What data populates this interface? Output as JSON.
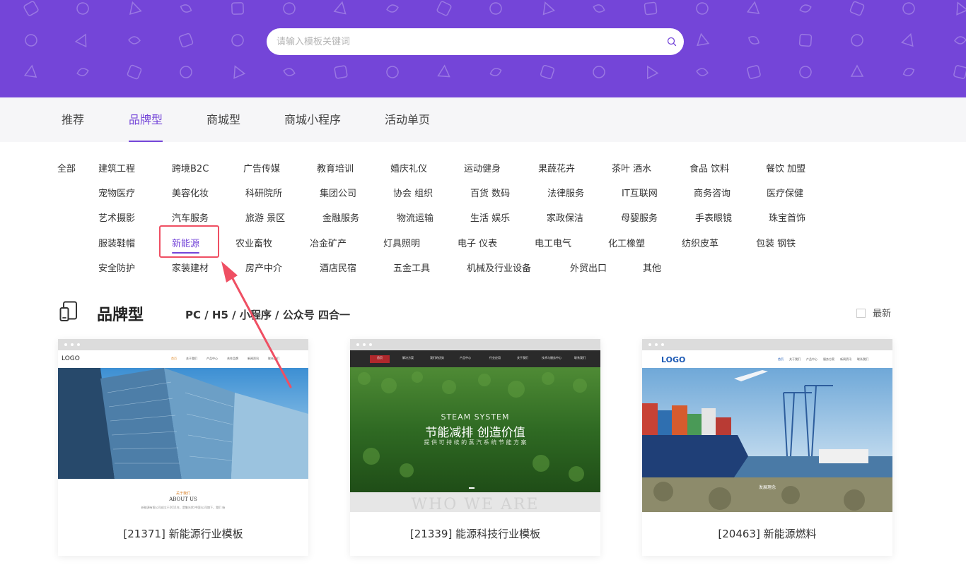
{
  "search": {
    "placeholder": "请输入模板关键词"
  },
  "tabs": [
    {
      "label": "推荐"
    },
    {
      "label": "品牌型",
      "active": true
    },
    {
      "label": "商城型"
    },
    {
      "label": "商城小程序"
    },
    {
      "label": "活动单页"
    }
  ],
  "categories": {
    "all": "全部",
    "row1": [
      "建筑工程",
      "跨境B2C",
      "广告传媒",
      "教育培训",
      "婚庆礼仪",
      "运动健身",
      "果蔬花卉",
      "茶叶 酒水",
      "食品 饮料",
      "餐饮 加盟"
    ],
    "row2": [
      "宠物医疗",
      "美容化妆",
      "科研院所",
      "集团公司",
      "协会 组织",
      "百货 数码",
      "法律服务",
      "IT互联网",
      "商务咨询",
      "医疗保健"
    ],
    "row3": [
      "艺术摄影",
      "汽车服务",
      "旅游 景区",
      "金融服务",
      "物流运输",
      "生活 娱乐",
      "家政保洁",
      "母婴服务",
      "手表眼镜",
      "珠宝首饰"
    ],
    "row4": [
      "服装鞋帽",
      "新能源",
      "农业畜牧",
      "冶金矿产",
      "灯具照明",
      "电子 仪表",
      "电工电气",
      "化工橡塑",
      "纺织皮革",
      "包装 钢铁"
    ],
    "row5": [
      "安全防护",
      "家装建材",
      "房产中介",
      "酒店民宿",
      "五金工具",
      "机械及行业设备",
      "外贸出口",
      "其他"
    ],
    "selected": "新能源"
  },
  "section": {
    "title": "品牌型",
    "subtitle": "PC / H5 / 小程序 / 公众号 四合一",
    "latest_label": "最新"
  },
  "cards": [
    {
      "caption": "[21371] 新能源行业模板",
      "preview": {
        "logo": "LOGO",
        "nav": [
          "首页",
          "关于我们",
          "产品中心",
          "合作品牌",
          "新闻资讯",
          "联系我们"
        ],
        "about_cn": "关于我们",
        "about_en": "ABOUT US",
        "about_text": "新能源有限公司成立于2011年，是集光伏(中国)公司旗下，我们 始"
      }
    },
    {
      "caption": "[21339] 能源科技行业模板",
      "preview": {
        "nav": [
          "首页",
          "解决方案",
          "我们的优势",
          "产品中心",
          "行业应用",
          "关于我们",
          "技术与服务中心",
          "联系我们"
        ],
        "hero_en": "STEAM SYSTEM",
        "hero_cn": "节能减排 创造价值",
        "hero_sub": "提 供 可 持 续 的 蒸 汽 系 统 节 能 方 案",
        "footer_en": "WHO WE ARE"
      }
    },
    {
      "caption": "[20463] 新能源燃料",
      "preview": {
        "logo": "LOGO",
        "nav": [
          "首页",
          "关于我们",
          "产品中心",
          "服务方案",
          "新闻资讯",
          "联系我们"
        ],
        "band_title": "发展理念"
      }
    }
  ],
  "colors": {
    "brand": "#7445d8",
    "annotation": "#ef4f63"
  }
}
